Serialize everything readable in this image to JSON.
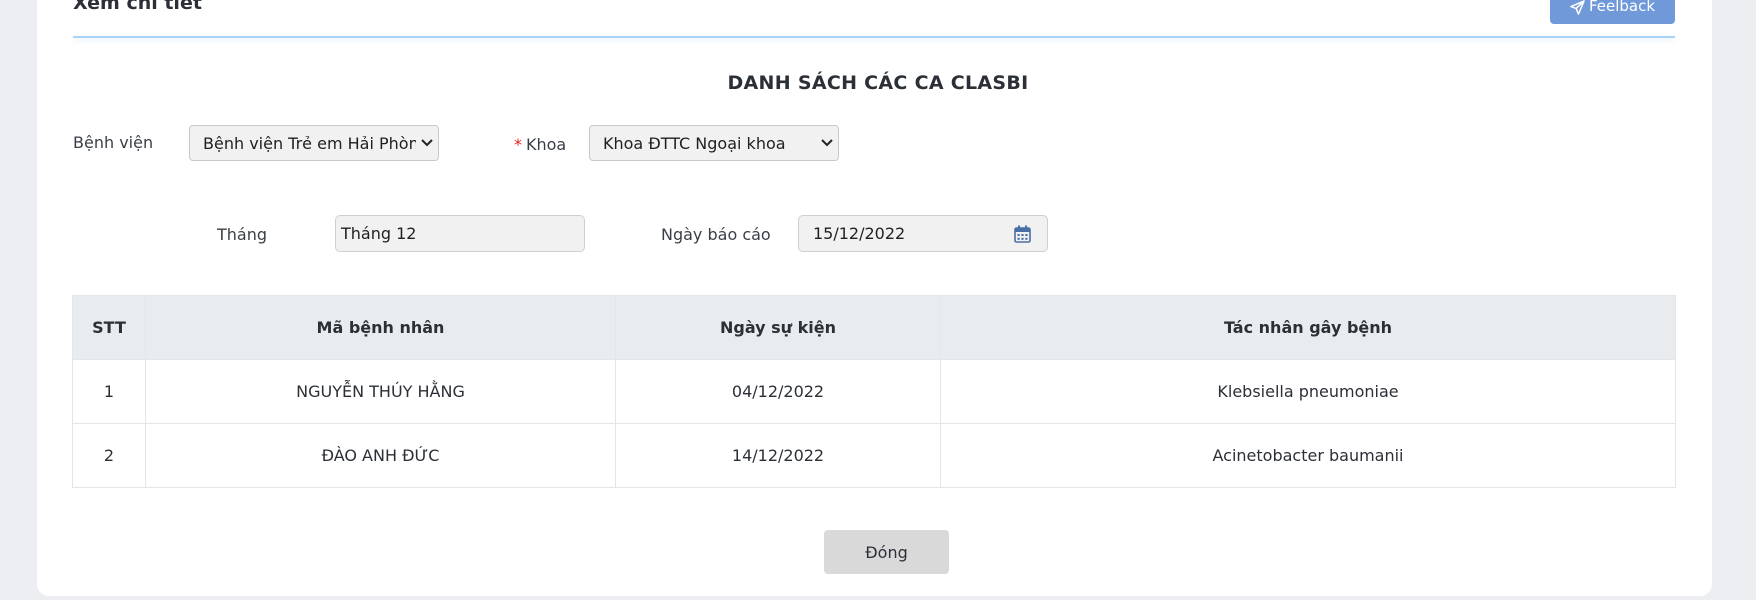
{
  "header": {
    "title": "Xem chi tiết",
    "feedback_label": "Feelback"
  },
  "section_title": "DANH SÁCH CÁC CA CLASBI",
  "filters": {
    "hospital": {
      "label": "Bệnh viện",
      "value": "Bệnh viện Trẻ em Hải Phòng"
    },
    "department": {
      "required": "*",
      "label": "Khoa",
      "value": "Khoa ĐTTC Ngoại khoa"
    },
    "month": {
      "label": "Tháng",
      "value": "Tháng 12"
    },
    "report_date": {
      "label": "Ngày báo cáo",
      "value": "15/12/2022"
    }
  },
  "table": {
    "columns": [
      "STT",
      "Mã bệnh nhân",
      "Ngày sự kiện",
      "Tác nhân gây bệnh"
    ],
    "rows": [
      [
        "1",
        "NGUYỄN THÚY HẰNG",
        "04/12/2022",
        "Klebsiella pneumoniae"
      ],
      [
        "2",
        "ĐÀO ANH ĐỨC",
        "14/12/2022",
        "Acinetobacter baumanii"
      ]
    ]
  },
  "footer": {
    "close_label": "Đóng"
  },
  "colors": {
    "accent_line": "#a9d2f6",
    "feedback_button": "#6f99d9",
    "required": "#e0261c",
    "table_header": "#e8ecef"
  },
  "icons": [
    "send-icon",
    "chevron-down-icon",
    "calendar-icon"
  ]
}
